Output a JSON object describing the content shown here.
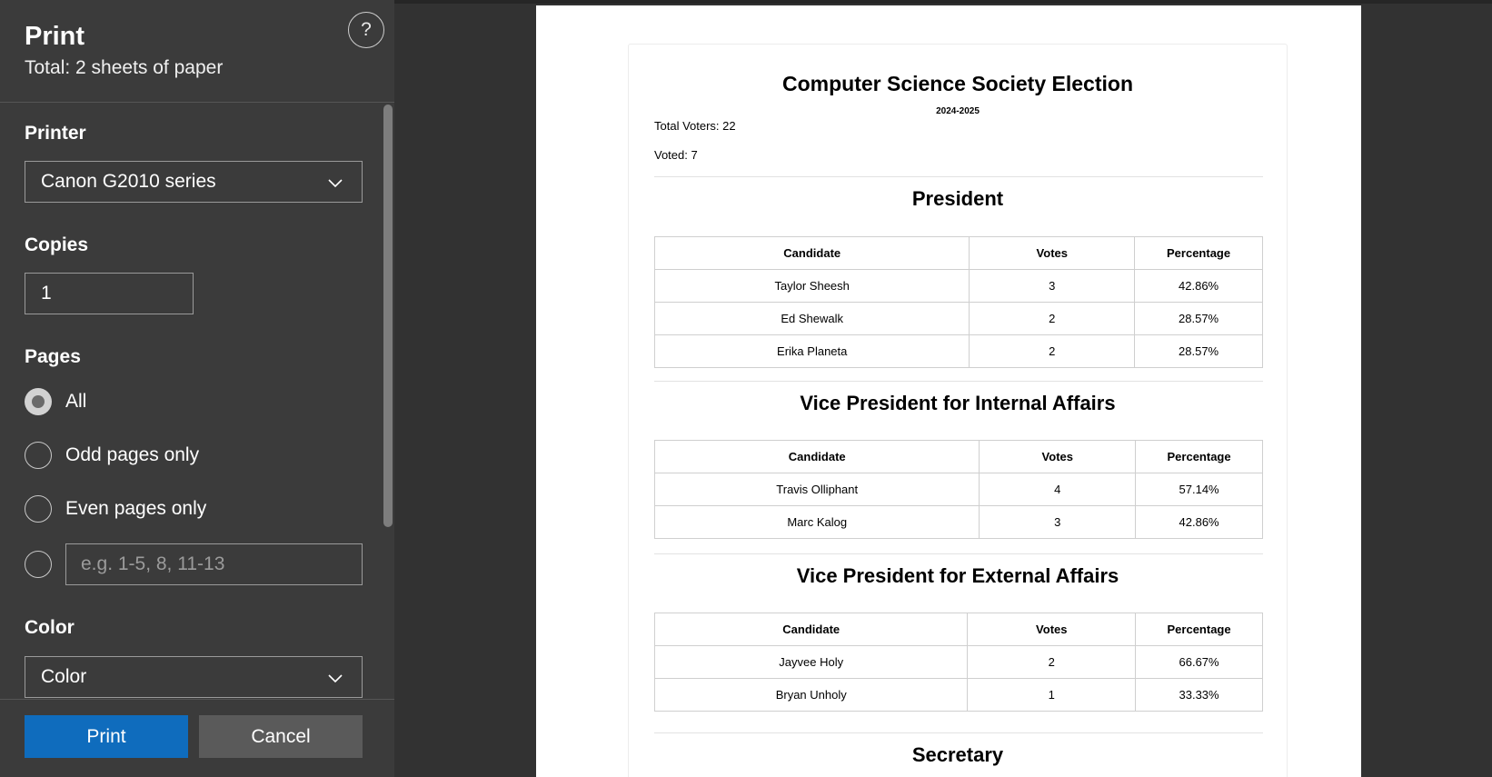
{
  "panel": {
    "title": "Print",
    "subtitle": "Total: 2 sheets of paper",
    "help_icon": "?",
    "printer": {
      "label": "Printer",
      "value": "Canon G2010 series"
    },
    "copies": {
      "label": "Copies",
      "value": "1"
    },
    "pages": {
      "label": "Pages",
      "options": [
        {
          "label": "All",
          "checked": true
        },
        {
          "label": "Odd pages only",
          "checked": false
        },
        {
          "label": "Even pages only",
          "checked": false
        }
      ],
      "custom_placeholder": "e.g. 1-5, 8, 11-13"
    },
    "color": {
      "label": "Color",
      "value": "Color"
    },
    "print_button": "Print",
    "cancel_button": "Cancel"
  },
  "document": {
    "title": "Computer Science Society Election",
    "year": "2024-2025",
    "total_voters": "Total Voters: 22",
    "voted": "Voted: 7",
    "table_headers": [
      "Candidate",
      "Votes",
      "Percentage"
    ],
    "sections": [
      {
        "title": "President",
        "rows": [
          [
            "Taylor Sheesh",
            "3",
            "42.86%"
          ],
          [
            "Ed Shewalk",
            "2",
            "28.57%"
          ],
          [
            "Erika Planeta",
            "2",
            "28.57%"
          ]
        ]
      },
      {
        "title": "Vice President for Internal Affairs",
        "rows": [
          [
            "Travis Olliphant",
            "4",
            "57.14%"
          ],
          [
            "Marc Kalog",
            "3",
            "42.86%"
          ]
        ]
      },
      {
        "title": "Vice President for External Affairs",
        "rows": [
          [
            "Jayvee Holy",
            "2",
            "66.67%"
          ],
          [
            "Bryan Unholy",
            "1",
            "33.33%"
          ]
        ]
      },
      {
        "title": "Secretary",
        "rows": []
      }
    ]
  },
  "colors": {
    "panel_bg": "#3b3b3b",
    "preview_bg": "#323232",
    "print_button": "#0f6cbd",
    "cancel_button": "#5a5a5a"
  }
}
